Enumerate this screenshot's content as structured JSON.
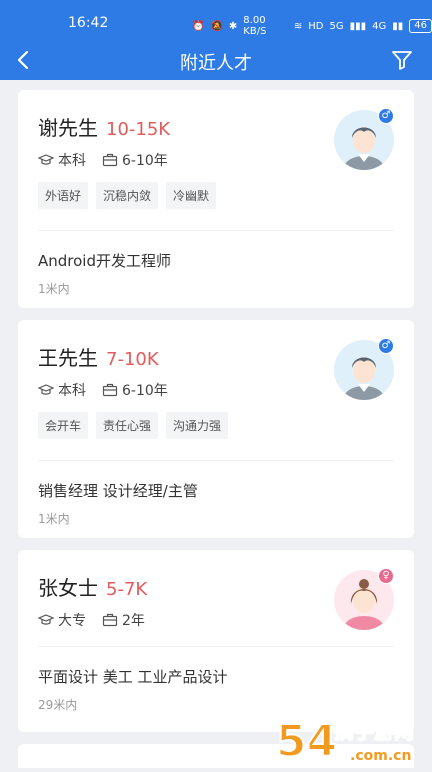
{
  "status": {
    "time": "16:42",
    "speed": "8.00 KB/S",
    "hd": "HD",
    "net1": "5G",
    "net2": "4G",
    "battery": "46"
  },
  "nav": {
    "title": "附近人才",
    "back_icon": "back-arrow-icon",
    "filter_icon": "filter-icon"
  },
  "colors": {
    "primary": "#2f7be5",
    "salary": "#e25c5c",
    "male": "#2f7be5",
    "female": "#e86a8f"
  },
  "cards": [
    {
      "name": "谢先生",
      "salary": "10-15K",
      "education": "本科",
      "experience": "6-10年",
      "tags": [
        "外语好",
        "沉稳内敛",
        "冷幽默"
      ],
      "job": "Android开发工程师",
      "distance": "1米内",
      "gender": "male"
    },
    {
      "name": "王先生",
      "salary": "7-10K",
      "education": "本科",
      "experience": "6-10年",
      "tags": [
        "会开车",
        "责任心强",
        "沟通力强"
      ],
      "job": "销售经理 设计经理/主管",
      "distance": "1米内",
      "gender": "male"
    },
    {
      "name": "张女士",
      "salary": "5-7K",
      "education": "大专",
      "experience": "2年",
      "tags": [],
      "job": "平面设计 美工 工业产品设计",
      "distance": "29米内",
      "gender": "female"
    }
  ],
  "watermark": {
    "text": "54搞手游网",
    "domain": ".com.cn"
  }
}
